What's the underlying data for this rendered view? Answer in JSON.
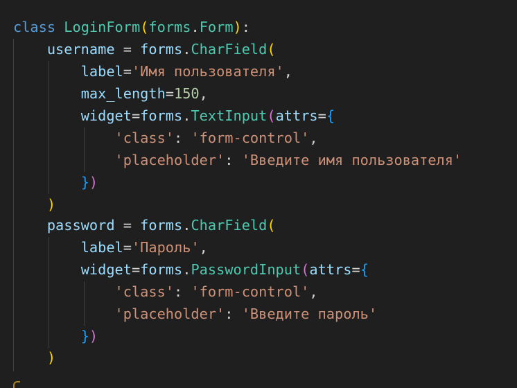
{
  "code": {
    "class_kw": "class",
    "class_name": "LoginForm",
    "base_module": "forms",
    "dot": ".",
    "base_class": "Form",
    "colon": ":",
    "lparen": "(",
    "rparen": ")",
    "lbrace": "{",
    "rbrace": "}",
    "eq_sp": " = ",
    "eq": "=",
    "comma": ",",
    "colon_sp": ": ",
    "username": {
      "name": "username",
      "module": "forms",
      "field": "CharField",
      "label_kw": "label",
      "label_val": "'Имя пользователя'",
      "max_length_kw": "max_length",
      "max_length_val": "150",
      "widget_kw": "widget",
      "widget_module": "forms",
      "widget_cls": "TextInput",
      "attrs_kw": "attrs",
      "class_key": "'class'",
      "class_val": "'form-control'",
      "placeholder_key": "'placeholder'",
      "placeholder_val": "'Введите имя пользователя'"
    },
    "password": {
      "name": "password",
      "module": "forms",
      "field": "CharField",
      "label_kw": "label",
      "label_val": "'Пароль'",
      "widget_kw": "widget",
      "widget_module": "forms",
      "widget_cls": "PasswordInput",
      "attrs_kw": "attrs",
      "class_key": "'class'",
      "class_val": "'form-control'",
      "placeholder_key": "'placeholder'",
      "placeholder_val": "'Введите пароль'"
    }
  },
  "colors": {
    "background": "#1f1f1f",
    "keyword": "#569cd6",
    "class_name": "#4ec9b0",
    "variable": "#9cdcfe",
    "string": "#ce9178",
    "number": "#b5cea8",
    "bracket_level_1": "#ffd700",
    "bracket_level_2": "#da70d6",
    "bracket_level_3": "#179fff"
  }
}
